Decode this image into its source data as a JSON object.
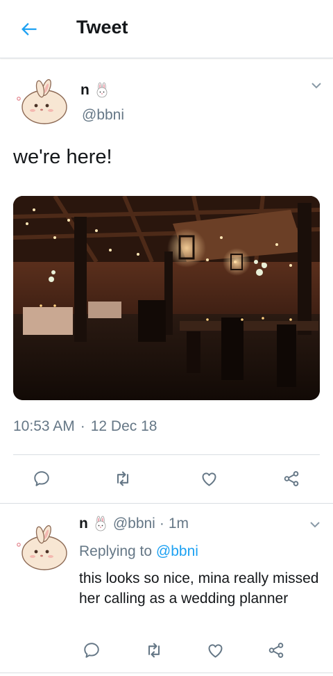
{
  "header": {
    "title": "Tweet"
  },
  "tweet": {
    "name": "n",
    "handle": "@bbni",
    "text": "we're here!",
    "time": "10:53 AM",
    "date": "12 Dec 18",
    "separator": "·"
  },
  "reply": {
    "name": "n",
    "handle": "@bbni",
    "time_ago": "1m",
    "separator": "·",
    "replying_prefix": "Replying to",
    "replying_to": "@bbni",
    "text": "this looks so nice, mina really missed her calling as a wedding planner"
  },
  "colors": {
    "accent": "#1da1f2",
    "secondary_text": "#657786",
    "divider": "#d9dee2"
  },
  "icons": [
    "back-arrow-icon",
    "chevron-down-icon",
    "reply-icon",
    "retweet-icon",
    "like-icon",
    "share-icon",
    "bunny-emoji-icon"
  ]
}
